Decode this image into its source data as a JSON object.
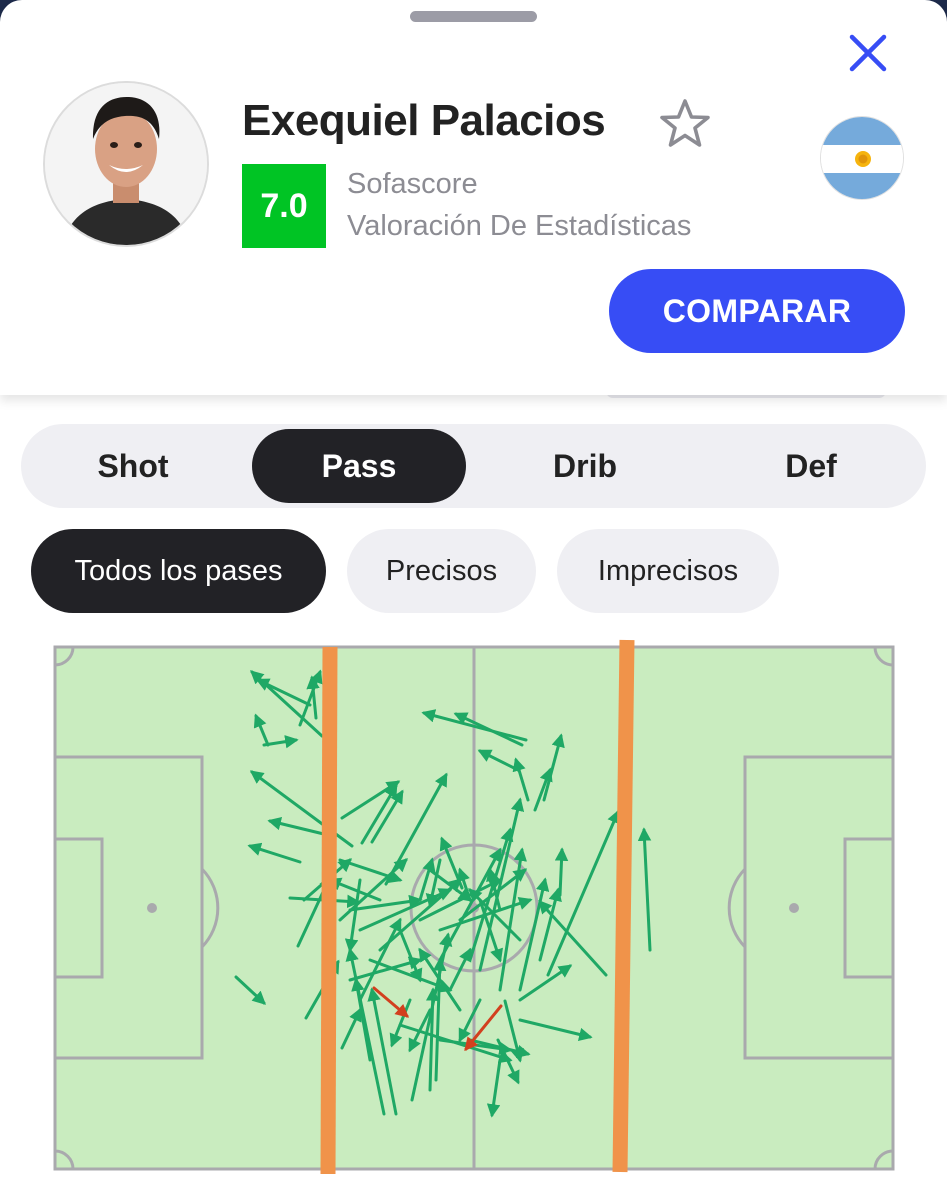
{
  "player": {
    "name": "Exequiel Palacios",
    "rating": "7.0",
    "rating_source": "Sofascore",
    "rating_label": "Valoración De Estadísticas",
    "nationality_flag": "argentina-flag"
  },
  "actions": {
    "compare_label": "COMPARAR"
  },
  "tabs": [
    {
      "label": "Shot",
      "active": false
    },
    {
      "label": "Pass",
      "active": true
    },
    {
      "label": "Drib",
      "active": false
    },
    {
      "label": "Def",
      "active": false
    }
  ],
  "filters": [
    {
      "label": "Todos los pases",
      "active": true
    },
    {
      "label": "Precisos",
      "active": false
    },
    {
      "label": "Imprecisos",
      "active": false
    }
  ],
  "colors": {
    "accent": "#374df5",
    "rating_bg": "#00c424",
    "accurate_pass": "#1fa865",
    "inaccurate_pass": "#d2401e",
    "pitch": "#c9ecbf",
    "zone_line": "#f0934a"
  },
  "pass_map": {
    "accurate_count": 76,
    "inaccurate_count": 2
  }
}
